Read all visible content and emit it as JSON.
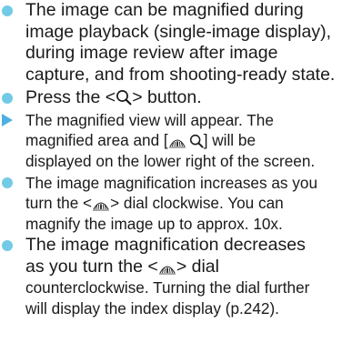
{
  "colors": {
    "bullet_dot": "#72cbe6",
    "bullet_arrow": "#4fb0de",
    "text": "#1a1a1a"
  },
  "icons": {
    "magnify": "magnify-icon",
    "main_dial": "main-dial-icon"
  },
  "items": [
    {
      "marker": "dot",
      "lines": [
        "The image can be magnified during",
        "image playback (single-image display),",
        "during image review after image",
        "capture, and from shooting-ready state."
      ]
    },
    {
      "marker": "dot",
      "line_before": "Press the <",
      "line_after": "> button."
    },
    {
      "marker": "arrow",
      "lines": [
        "The magnified view will appear. The"
      ],
      "line2_before": "magnified area and [",
      "line2_after": "] will be",
      "line3": "displayed on the lower right of the screen."
    },
    {
      "marker": "dot",
      "line1": "The image magnification increases as you",
      "line2_before": "turn the <",
      "line2_after": "> dial clockwise. You can",
      "line3": "magnify the image up to approx. 10x."
    },
    {
      "marker": "dot",
      "line1": "The image magnification decreases",
      "line2_before": "as you turn the <",
      "line2_after": "> dial",
      "line3": "counterclockwise. Turning the dial further",
      "line4": "will display the index display (p.242)."
    }
  ]
}
